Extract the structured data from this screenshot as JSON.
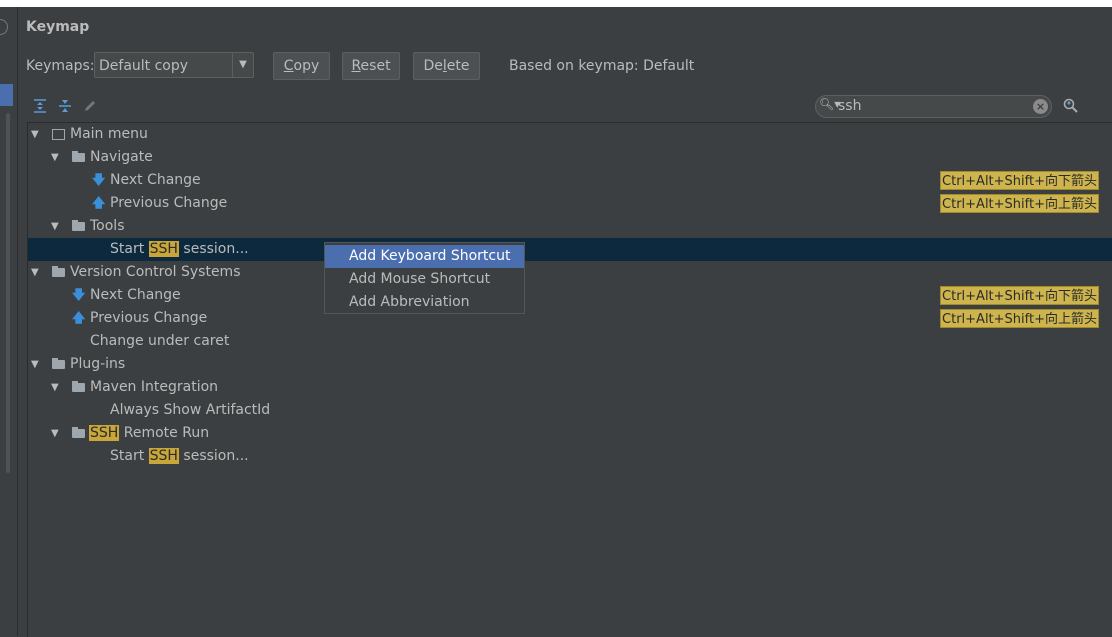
{
  "dialog": {
    "title": "Keymap"
  },
  "toolbar": {
    "keymaps_label": "Keymaps:",
    "keymap_selected": "Default copy",
    "copy_prefix": "",
    "copy_u": "C",
    "copy_rest": "opy",
    "reset_prefix": "",
    "reset_u": "R",
    "reset_rest": "eset",
    "delete_prefix": "De",
    "delete_u": "l",
    "delete_rest": "ete",
    "based_on": "Based on keymap: Default"
  },
  "search": {
    "value": "ssh"
  },
  "tree": {
    "main_menu": "Main menu",
    "navigate": "Navigate",
    "nav_next_change": "Next Change",
    "nav_next_change_shortcut": "Ctrl+Alt+Shift+向下箭头",
    "nav_prev_change": "Previous Change",
    "nav_prev_change_shortcut": "Ctrl+Alt+Shift+向上箭头",
    "tools": "Tools",
    "tools_start_pre": "Start ",
    "tools_start_hl": "SSH",
    "tools_start_post": " session...",
    "vcs": "Version Control Systems",
    "vcs_next_change": "Next Change",
    "vcs_next_change_shortcut": "Ctrl+Alt+Shift+向下箭头",
    "vcs_prev_change": "Previous Change",
    "vcs_prev_change_shortcut": "Ctrl+Alt+Shift+向上箭头",
    "vcs_change_under_caret": "Change under caret",
    "plugins": "Plug-ins",
    "maven": "Maven Integration",
    "maven_always_show": "Always Show ArtifactId",
    "ssh_remote_hl": "SSH",
    "ssh_remote_post": " Remote Run",
    "ssh_start_pre": "Start ",
    "ssh_start_hl": "SSH",
    "ssh_start_post": " session..."
  },
  "context_menu": {
    "items": [
      "Add Keyboard Shortcut",
      "Add Mouse Shortcut",
      "Add Abbreviation"
    ],
    "active_index": 0
  },
  "colors": {
    "background": "#3c3f41",
    "selection": "#0d293e",
    "menu_highlight": "#4b6eaf",
    "search_match": "#c9a63a",
    "shortcut_badge": "#cdb44c"
  }
}
